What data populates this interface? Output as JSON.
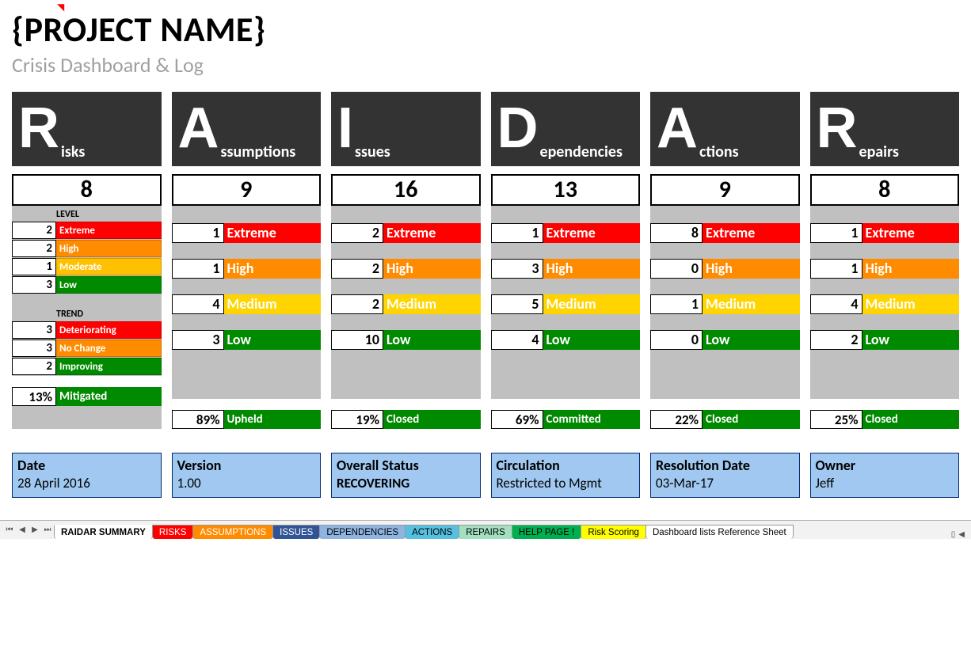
{
  "title": "{PROJECT NAME}",
  "subtitle": "Crisis Dashboard & Log",
  "columns": [
    {
      "letter": "R",
      "word": "isks",
      "count": "8",
      "levelHeader": "LEVEL",
      "levels": [
        {
          "n": "2",
          "label": "Extreme",
          "cls": "c-extreme",
          "small": true
        },
        {
          "n": "2",
          "label": "High",
          "cls": "c-high",
          "small": true
        },
        {
          "n": "1",
          "label": "Moderate",
          "cls": "c-moderate",
          "small": true
        },
        {
          "n": "3",
          "label": "Low",
          "cls": "c-low",
          "small": true
        }
      ],
      "trendHeader": "TREND",
      "trends": [
        {
          "n": "3",
          "label": "Deteriorating",
          "cls": "c-det",
          "small": true
        },
        {
          "n": "3",
          "label": "No Change",
          "cls": "c-nc",
          "small": true
        },
        {
          "n": "2",
          "label": "Improving",
          "cls": "c-imp",
          "small": true
        }
      ],
      "pct": {
        "n": "13%",
        "label": "Mitigated"
      }
    },
    {
      "letter": "A",
      "word": "ssumptions",
      "count": "9",
      "bigLevels": [
        {
          "n": "1",
          "label": "Extreme",
          "cls": "c-extreme"
        },
        {
          "n": "1",
          "label": "High",
          "cls": "c-high"
        },
        {
          "n": "4",
          "label": "Medium",
          "cls": "c-medium"
        },
        {
          "n": "3",
          "label": "Low",
          "cls": "c-low"
        }
      ],
      "pct": {
        "n": "89%",
        "label": "Upheld"
      }
    },
    {
      "letter": "I",
      "word": "ssues",
      "count": "16",
      "bigLevels": [
        {
          "n": "2",
          "label": "Extreme",
          "cls": "c-extreme"
        },
        {
          "n": "2",
          "label": "High",
          "cls": "c-high"
        },
        {
          "n": "2",
          "label": "Medium",
          "cls": "c-medium"
        },
        {
          "n": "10",
          "label": "Low",
          "cls": "c-low"
        }
      ],
      "pct": {
        "n": "19%",
        "label": "Closed"
      }
    },
    {
      "letter": "D",
      "word": "ependencies",
      "count": "13",
      "bigLevels": [
        {
          "n": "1",
          "label": "Extreme",
          "cls": "c-extreme"
        },
        {
          "n": "3",
          "label": "High",
          "cls": "c-high"
        },
        {
          "n": "5",
          "label": "Medium",
          "cls": "c-medium"
        },
        {
          "n": "4",
          "label": "Low",
          "cls": "c-low"
        }
      ],
      "pct": {
        "n": "69%",
        "label": "Committed"
      }
    },
    {
      "letter": "A",
      "word": "ctions",
      "count": "9",
      "bigLevels": [
        {
          "n": "8",
          "label": "Extreme",
          "cls": "c-extreme"
        },
        {
          "n": "0",
          "label": "High",
          "cls": "c-high"
        },
        {
          "n": "1",
          "label": "Medium",
          "cls": "c-medium"
        },
        {
          "n": "0",
          "label": "Low",
          "cls": "c-low"
        }
      ],
      "pct": {
        "n": "22%",
        "label": "Closed"
      }
    },
    {
      "letter": "R",
      "word": "epairs",
      "count": "8",
      "bigLevels": [
        {
          "n": "1",
          "label": "Extreme",
          "cls": "c-extreme"
        },
        {
          "n": "1",
          "label": "High",
          "cls": "c-high"
        },
        {
          "n": "4",
          "label": "Medium",
          "cls": "c-medium"
        },
        {
          "n": "2",
          "label": "Low",
          "cls": "c-low"
        }
      ],
      "pct": {
        "n": "25%",
        "label": "Closed"
      }
    }
  ],
  "info": [
    {
      "label": "Date",
      "value": "28 April 2016"
    },
    {
      "label": "Version",
      "value": "1.00"
    },
    {
      "label": "Overall Status",
      "value": "RECOVERING",
      "bold": true
    },
    {
      "label": "Circulation",
      "value": "Restricted to Mgmt"
    },
    {
      "label": "Resolution Date",
      "value": "03-Mar-17"
    },
    {
      "label": "Owner",
      "value": "Jeff"
    }
  ],
  "tabs": [
    {
      "label": "RAIDAR SUMMARY",
      "cls": "active"
    },
    {
      "label": "RISKS",
      "cls": "t-risks"
    },
    {
      "label": "ASSUMPTIONS",
      "cls": "t-assum"
    },
    {
      "label": "ISSUES",
      "cls": "t-issues"
    },
    {
      "label": "DEPENDENCIES",
      "cls": "t-deps"
    },
    {
      "label": "ACTIONS",
      "cls": "t-actions"
    },
    {
      "label": "REPAIRS",
      "cls": "t-repairs"
    },
    {
      "label": "HELP PAGE !",
      "cls": "t-help"
    },
    {
      "label": "Risk Scoring",
      "cls": "t-risksc"
    },
    {
      "label": "Dashboard lists Reference Sheet",
      "cls": "t-ref"
    }
  ]
}
